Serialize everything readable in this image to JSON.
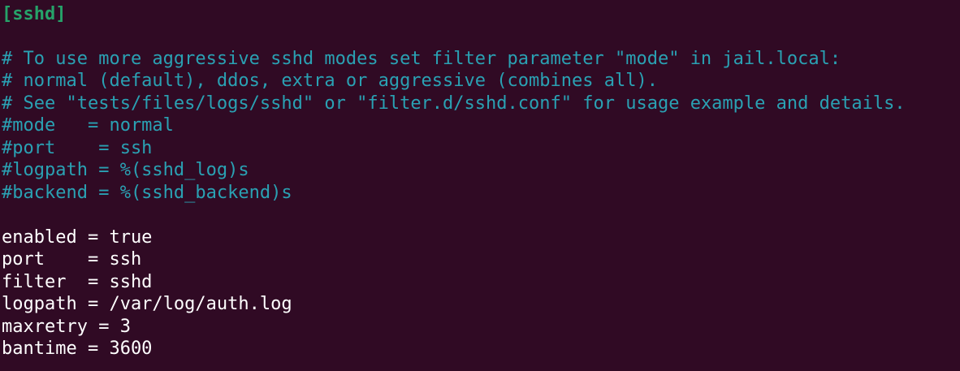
{
  "terminal": {
    "background": "#300a24",
    "colors": {
      "section": "#26a269",
      "comment": "#2aa1b3",
      "setting": "#ffffff"
    },
    "lines": [
      "[sshd]",
      "",
      "# To use more aggressive sshd modes set filter parameter \"mode\" in jail.local:",
      "# normal (default), ddos, extra or aggressive (combines all).",
      "# See \"tests/files/logs/sshd\" or \"filter.d/sshd.conf\" for usage example and details.",
      "#mode   = normal",
      "#port    = ssh",
      "#logpath = %(sshd_log)s",
      "#backend = %(sshd_backend)s",
      "",
      "enabled = true",
      "port    = ssh",
      "filter  = sshd",
      "logpath = /var/log/auth.log",
      "maxretry = 3",
      "bantime = 3600"
    ]
  }
}
